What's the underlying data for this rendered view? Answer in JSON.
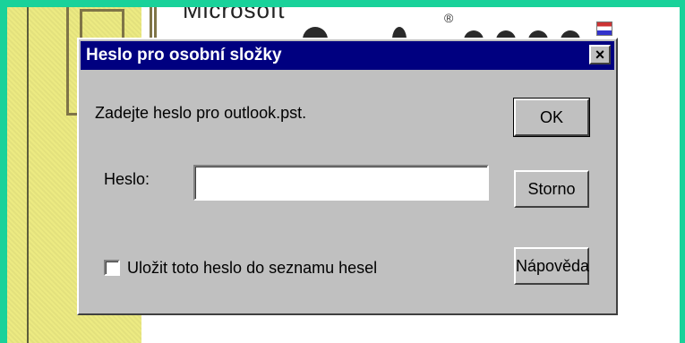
{
  "background": {
    "brand_text": "Microsoft",
    "registered_mark": "®"
  },
  "dialog": {
    "title": "Heslo pro osobní složky",
    "close_glyph": "×",
    "prompt": "Zadejte heslo pro outlook.pst.",
    "password_label": "Heslo:",
    "password_value": "",
    "remember_label": "Uložit toto heslo do seznamu hesel",
    "remember_checked": false,
    "buttons": {
      "ok": "OK",
      "cancel": "Storno",
      "help": "Nápověda"
    }
  },
  "colors": {
    "titlebar": "#000080",
    "dialog_face": "#c0c0c0",
    "frame": "#19d29a"
  }
}
